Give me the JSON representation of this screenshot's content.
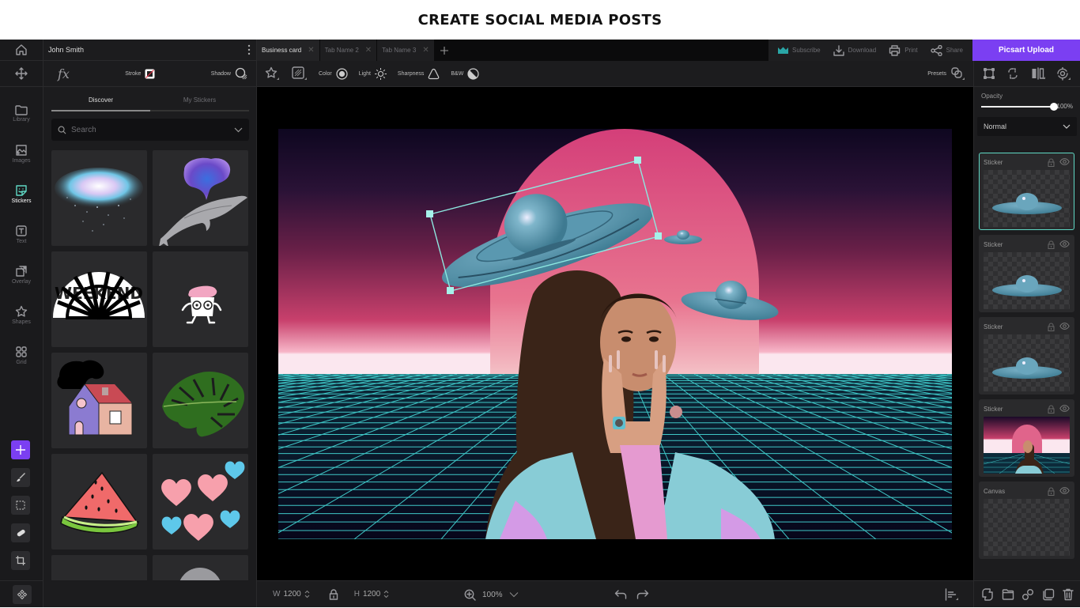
{
  "banner": {
    "title": "CREATE SOCIAL MEDIA POSTS"
  },
  "colors": {
    "accent": "#7b3ff2",
    "selection": "#5fd8c4",
    "background": "#1c1c1e"
  },
  "user": {
    "name": "John Smith"
  },
  "rail": {
    "items": [
      {
        "label": "Library",
        "icon": "folder-icon"
      },
      {
        "label": "Images",
        "icon": "image-icon"
      },
      {
        "label": "Stickers",
        "icon": "sticker-icon",
        "active": true
      },
      {
        "label": "Text",
        "icon": "text-icon"
      },
      {
        "label": "Overlay",
        "icon": "overlay-icon"
      },
      {
        "label": "Shapes",
        "icon": "star-icon"
      },
      {
        "label": "Grid",
        "icon": "grid-icon"
      }
    ],
    "tools": [
      "add-icon",
      "brush-icon",
      "select-icon",
      "eraser-icon",
      "crop-icon"
    ]
  },
  "left_panel": {
    "fx_label": "fx",
    "stroke_label": "Stroke",
    "shadow_label": "Shadow",
    "tabs": [
      {
        "label": "Discover",
        "active": true
      },
      {
        "label": "My Stickers"
      }
    ],
    "search": {
      "placeholder": "Search",
      "value": ""
    },
    "stickers": [
      "Galaxy cloud",
      "Whale with nebula",
      "Weekend fan",
      "Cupcake character",
      "House with smoke",
      "Monstera leaf",
      "Watermelon slice",
      "Hearts",
      "Sticker",
      "Moon"
    ]
  },
  "doc_tabs": [
    {
      "label": "Business card",
      "active": true
    },
    {
      "label": "Tab Name 2"
    },
    {
      "label": "Tab Name 3"
    }
  ],
  "top_actions": {
    "subscribe": "Subscribe",
    "download": "Download",
    "print": "Print",
    "share": "Share",
    "upload": "Picsart Upload"
  },
  "adjust": {
    "color": "Color",
    "light": "Light",
    "sharpness": "Sharpness",
    "bw": "B&W",
    "presets": "Presets"
  },
  "bottom": {
    "w_label": "W",
    "w_value": "1200",
    "h_label": "H",
    "h_value": "1200",
    "zoom": "100%"
  },
  "right_panel": {
    "opacity_label": "Opacity",
    "opacity_value": "100%",
    "opacity_fraction": 1.0,
    "blend_mode": "Normal",
    "layers": [
      {
        "name": "Sticker",
        "selected": true,
        "kind": "ufo"
      },
      {
        "name": "Sticker",
        "kind": "ufo"
      },
      {
        "name": "Sticker",
        "kind": "ufo"
      },
      {
        "name": "Sticker",
        "kind": "scene"
      },
      {
        "name": "Canvas",
        "kind": "empty"
      }
    ]
  }
}
